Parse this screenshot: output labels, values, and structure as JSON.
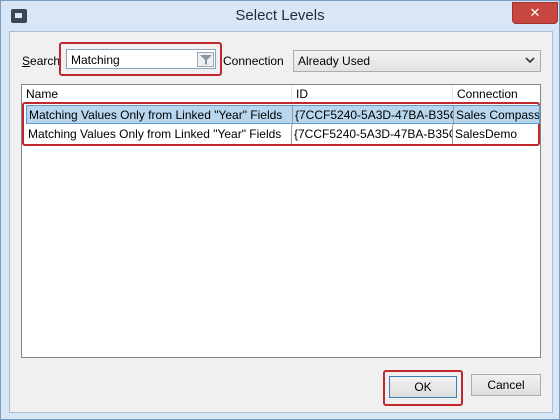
{
  "window": {
    "title": "Select Levels",
    "close_glyph": "✕"
  },
  "search": {
    "label_underlined": "S",
    "label_rest": "earch",
    "value": "Matching"
  },
  "connection": {
    "label": "Connection",
    "selected": "Already Used"
  },
  "table": {
    "columns": [
      "Name",
      "ID",
      "Connection"
    ],
    "rows": [
      {
        "name": "Matching Values Only from Linked \"Year\" Fields",
        "id": "{7CCF5240-5A3D-47BA-B35C-",
        "connection": "Sales Compass",
        "selected": true
      },
      {
        "name": "Matching Values Only from Linked \"Year\" Fields",
        "id": "{7CCF5240-5A3D-47BA-B35C-",
        "connection": "SalesDemo",
        "selected": false
      }
    ]
  },
  "buttons": {
    "ok": "OK",
    "cancel": "Cancel"
  },
  "colors": {
    "highlight_box": "#c0282d",
    "selected_row": "#b8d7ee",
    "title_bar": "#d8e6f5",
    "close_button": "#c7463f"
  }
}
